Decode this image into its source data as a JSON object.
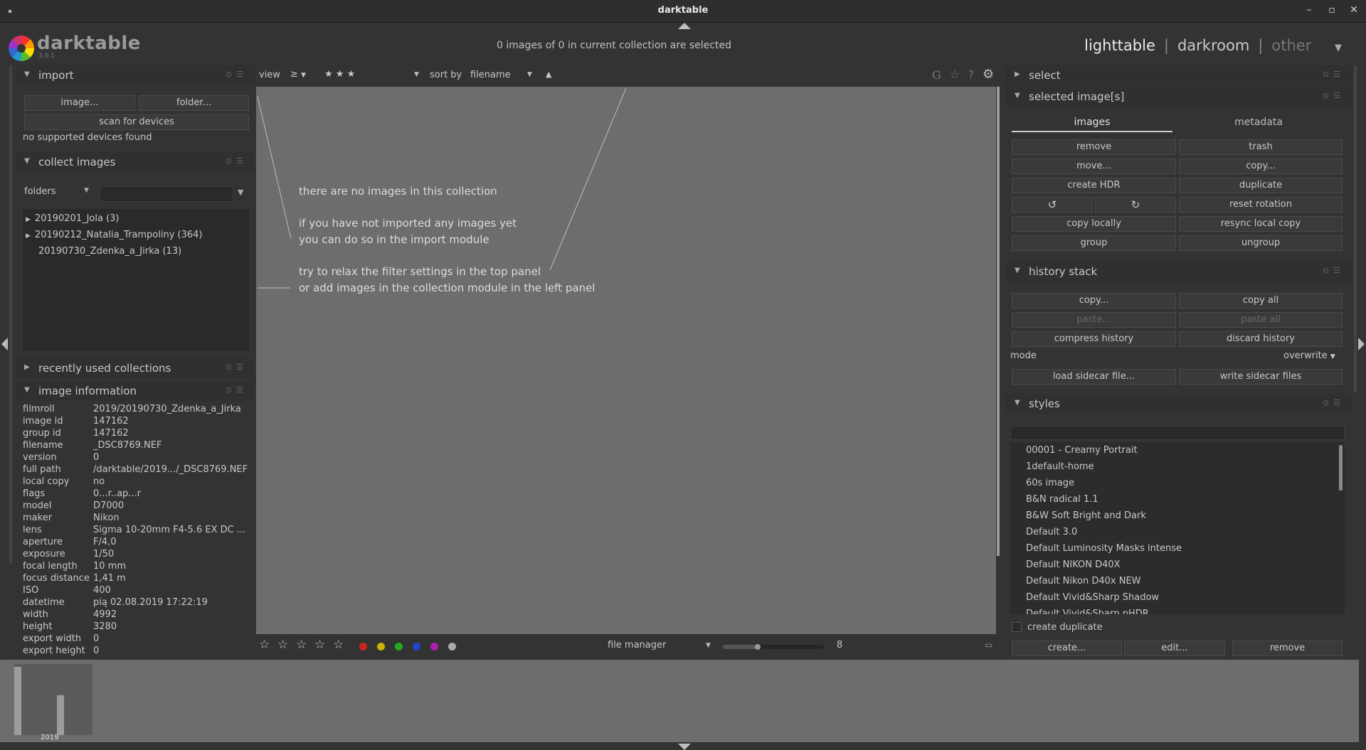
{
  "window": {
    "title": "darktable",
    "minimize": "–",
    "maximize": "▫",
    "close": "✕"
  },
  "header": {
    "logo_text": "darktable",
    "version": "3.0.1",
    "selection_status": "0 images of 0 in current collection are selected",
    "views": [
      "lighttable",
      "darkroom",
      "other"
    ],
    "separator": "|"
  },
  "left": {
    "import": {
      "title": "import",
      "btn_image": "image...",
      "btn_folder": "folder...",
      "btn_scan": "scan for devices",
      "status": "no supported devices found"
    },
    "collect": {
      "title": "collect images",
      "combo_value": "folders",
      "folders": [
        {
          "label": "20190201_Jola (3)",
          "expandable": true
        },
        {
          "label": "20190212_Natalia_Trampoliny (364)",
          "expandable": true
        },
        {
          "label": "20190730_Zdenka_a_Jirka (13)",
          "expandable": false
        }
      ]
    },
    "recent": {
      "title": "recently used collections"
    },
    "info": {
      "title": "image information",
      "rows": [
        [
          "filmroll",
          "2019/20190730_Zdenka_a_Jirka"
        ],
        [
          "image id",
          "147162"
        ],
        [
          "group id",
          "147162"
        ],
        [
          "filename",
          "_DSC8769.NEF"
        ],
        [
          "version",
          "0"
        ],
        [
          "full path",
          "/darktable/2019.../_DSC8769.NEF"
        ],
        [
          "local copy",
          "no"
        ],
        [
          "flags",
          "0...r..ap...r"
        ],
        [
          "model",
          "D7000"
        ],
        [
          "maker",
          "Nikon"
        ],
        [
          "lens",
          "Sigma 10-20mm F4-5.6 EX DC ..."
        ],
        [
          "aperture",
          "F/4,0"
        ],
        [
          "exposure",
          "1/50"
        ],
        [
          "focal length",
          "10 mm"
        ],
        [
          "focus distance",
          "1,41 m"
        ],
        [
          "ISO",
          "400"
        ],
        [
          "datetime",
          "pią 02.08.2019 17:22:19"
        ],
        [
          "width",
          "4992"
        ],
        [
          "height",
          "3280"
        ],
        [
          "export width",
          "0"
        ],
        [
          "export height",
          "0"
        ]
      ]
    }
  },
  "filterbar": {
    "view_label": "view",
    "comparator": "≥",
    "rating": "★ ★ ★",
    "sort_label": "sort by",
    "sort_value": "filename",
    "sort_dir": "▲"
  },
  "canvas": {
    "line1": "there are no images in this collection",
    "line2": "if you have not imported any images yet",
    "line3": "you can do so in the import module",
    "line4": "try to relax the filter settings in the top panel",
    "line5": "or add images in the collection module in the left panel"
  },
  "bottombar": {
    "layout_value": "file manager",
    "zoom_value": "8",
    "colors": [
      "#cc2222",
      "#c8b400",
      "#22aa22",
      "#2244cc",
      "#aa22aa",
      "#aaaaaa"
    ]
  },
  "right": {
    "select": {
      "title": "select"
    },
    "selected": {
      "title": "selected image[s]",
      "tab_images": "images",
      "tab_metadata": "metadata",
      "btn_remove": "remove",
      "btn_trash": "trash",
      "btn_move": "move...",
      "btn_copy": "copy...",
      "btn_hdr": "create HDR",
      "btn_duplicate": "duplicate",
      "btn_reset_rotation": "reset rotation",
      "btn_copy_locally": "copy locally",
      "btn_resync": "resync local copy",
      "btn_group": "group",
      "btn_ungroup": "ungroup"
    },
    "history": {
      "title": "history stack",
      "btn_copy": "copy...",
      "btn_copy_all": "copy all",
      "btn_paste": "paste...",
      "btn_paste_all": "paste all",
      "btn_compress": "compress history",
      "btn_discard": "discard history",
      "mode_label": "mode",
      "mode_value": "overwrite",
      "btn_load": "load sidecar file...",
      "btn_write": "write sidecar files"
    },
    "styles": {
      "title": "styles",
      "items": [
        "00001 - Creamy Portrait",
        "1default-home",
        "60s image",
        "B&N radical 1.1",
        "B&W Soft Bright and Dark",
        "Default 3.0",
        "Default Luminosity Masks intense",
        "Default NIKON D40X",
        "Default Nikon D40x NEW",
        "Default Vivid&Sharp Shadow",
        "Default Vivid&Sharp pHDR"
      ],
      "create_duplicate": "create duplicate",
      "btn_create": "create...",
      "btn_edit": "edit...",
      "btn_remove": "remove"
    }
  },
  "timeline": {
    "year": "2019"
  }
}
